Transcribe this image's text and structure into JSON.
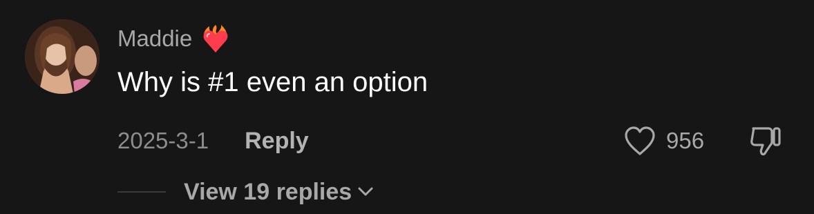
{
  "comment": {
    "username": "Maddie",
    "username_badge_icon": "heart-on-fire-icon",
    "text": "Why is #1 even an option",
    "date": "2025-3-1",
    "reply_label": "Reply",
    "like_icon": "heart-outline-icon",
    "like_count": "956",
    "dislike_icon": "thumbs-down-icon",
    "view_replies_label": "View 19 replies",
    "view_replies_icon": "chevron-down-icon"
  },
  "colors": {
    "background": "#161616",
    "username": "#a8a8a8",
    "text": "#ffffff",
    "muted": "#8d8d8d",
    "badge": "#ff4d5e"
  }
}
